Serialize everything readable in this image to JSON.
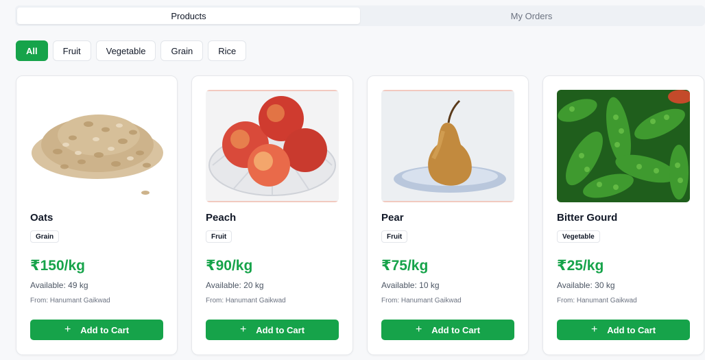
{
  "tabs": [
    {
      "label": "Products",
      "active": true
    },
    {
      "label": "My Orders",
      "active": false
    }
  ],
  "filters": [
    {
      "label": "All",
      "active": true
    },
    {
      "label": "Fruit",
      "active": false
    },
    {
      "label": "Vegetable",
      "active": false
    },
    {
      "label": "Grain",
      "active": false
    },
    {
      "label": "Rice",
      "active": false
    }
  ],
  "products": [
    {
      "name": "Oats",
      "category": "Grain",
      "price": "₹150/kg",
      "available": "Available: 49 kg",
      "from": "From: Hanumant Gaikwad",
      "cart_label": "Add to Cart",
      "image": "oats-image"
    },
    {
      "name": "Peach",
      "category": "Fruit",
      "price": "₹90/kg",
      "available": "Available: 20 kg",
      "from": "From: Hanumant Gaikwad",
      "cart_label": "Add to Cart",
      "image": "peach-image"
    },
    {
      "name": "Pear",
      "category": "Fruit",
      "price": "₹75/kg",
      "available": "Available: 10 kg",
      "from": "From: Hanumant Gaikwad",
      "cart_label": "Add to Cart",
      "image": "pear-image"
    },
    {
      "name": "Bitter Gourd",
      "category": "Vegetable",
      "price": "₹25/kg",
      "available": "Available: 30 kg",
      "from": "From: Hanumant Gaikwad",
      "cart_label": "Add to Cart",
      "image": "bitter-gourd-image"
    }
  ],
  "colors": {
    "accent": "#16a34a",
    "background": "#f7f8fa"
  },
  "icons": {
    "add": "plus-icon"
  }
}
